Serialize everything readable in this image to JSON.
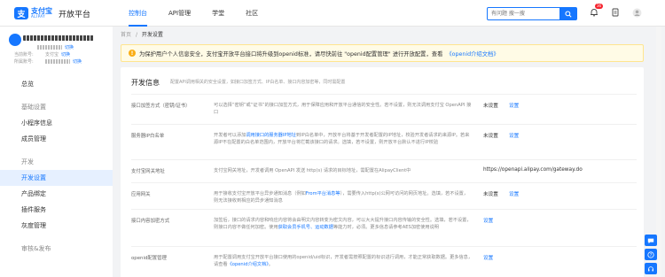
{
  "header": {
    "logo_text": "支付宝",
    "logo_subtext": "ALIPAY",
    "platform_name": "开放平台",
    "nav": [
      "控制台",
      "API管理",
      "学堂",
      "社区"
    ],
    "active_nav": "控制台",
    "search_placeholder": "有问题 搜一搜",
    "notification_count": "36"
  },
  "account": {
    "appid_label": "当前账号:",
    "appid_value": "支付宝",
    "switch_label": "切换",
    "merchant_label": "所属账号:",
    "merchant_link": "切换"
  },
  "sidebar": {
    "items": [
      {
        "label": "总览",
        "type": "item"
      },
      {
        "label": "基础设置",
        "type": "group"
      },
      {
        "label": "小程序信息",
        "type": "item"
      },
      {
        "label": "成员管理",
        "type": "item"
      },
      {
        "label": "开发",
        "type": "group"
      },
      {
        "label": "开发设置",
        "type": "item",
        "active": true
      },
      {
        "label": "产品绑定",
        "type": "item"
      },
      {
        "label": "插件服务",
        "type": "item"
      },
      {
        "label": "灰度管理",
        "type": "item"
      },
      {
        "label": "审核&发布",
        "type": "group"
      }
    ]
  },
  "breadcrumb": {
    "home": "首页",
    "separator": "/",
    "current": "开发设置"
  },
  "notice": {
    "text": "为保护用户个人信息安全，支付宝开放平台接口将升级到openid标准，请尽快前往 \"openid配置管理\" 进行开放配置，查看",
    "link": "《openid介绍文档》"
  },
  "panel": {
    "title": "开发信息",
    "description": "配置API调用相关的安全设置，如接口加签方式、IP白名单、接口内容加密等，同时需配置",
    "rows": [
      {
        "label": "接口加签方式（密钥/证书）",
        "desc_pre": "可以选择“密钥”或“证书”的接口加签方式，用于保障应用和开放平台通信的安全性。若不设置，则无法调用支付宝 OpenAPI 接口",
        "desc_link": "",
        "desc_post": "",
        "status": "未设置",
        "action": "设置"
      },
      {
        "label": "服务器IP白名单",
        "desc_pre": "开发者可以添加",
        "desc_link": "调用接口的服务器IP地址",
        "desc_post": "到IP白名单中，开放平台将基于开发者配置的IP地址，校验开发者请求的来源IP。若来源IP不在配置的白名单范围内，开放平台将拦截该接口的请求。选填，若不设置，则开放平台默认不进行IP校验",
        "status": "未设置",
        "action": "设置"
      },
      {
        "label": "支付宝网关地址",
        "desc_pre": "支付宝网关地址，开发者调用 OpenAPI 发送 http(s) 请求的目标地址，需配置在AlipayClient中",
        "desc_link": "",
        "desc_post": "",
        "url": "https://openapi.alipay.com/gateway.do"
      },
      {
        "label": "应用网关",
        "desc_pre": "用于接收支付宝开放平台异步通知消息（例如",
        "desc_link": "From平台消息等",
        "desc_post": "），需要传入http(s)公网可访问的网页地址。选填，若不设置，则无法接收到相应的异步通知消息",
        "status": "未设置",
        "action": "设置"
      },
      {
        "label": "接口内容加密方式",
        "desc_pre": "加签后，接口的请求内容和响应内容将会由明文内容转变为密文内容，可以大大提升接口内容传输的安全性。选填，若不设置，则接口内容不做任何加密。使用",
        "desc_link": "获取会员手机号、运动数据",
        "desc_post": "等能力时，必须。更多信息请参考AES加密使用说明",
        "action": "设置"
      },
      {
        "label": "openid配置管理",
        "desc_pre": "用于配置调用支付宝开放平台接口使用的openid/uid标识，开发者需按照配置的标识进行调用，才能正常获取数据。更多信息，请查看",
        "desc_link": "《openid介绍文档》",
        "desc_post": "。",
        "action": "设置"
      }
    ]
  }
}
